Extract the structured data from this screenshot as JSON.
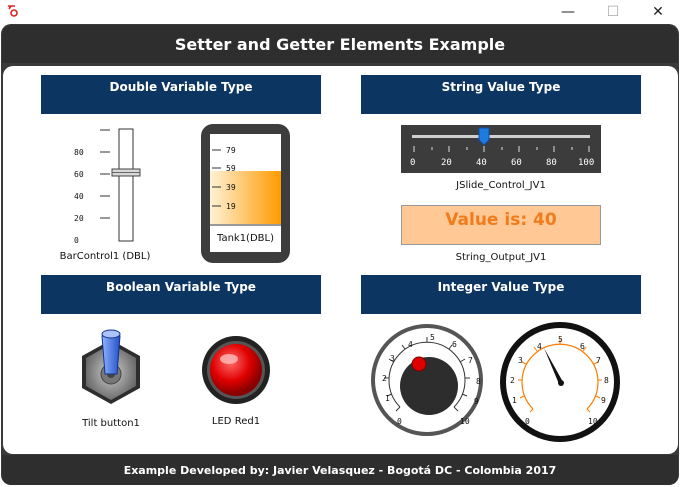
{
  "window": {
    "minimize": "—",
    "maximize": "☐",
    "close": "✕"
  },
  "header": {
    "title": "Setter and Getter Elements Example"
  },
  "footer": {
    "text": "Example Developed by: Javier Velasquez - Bogotá DC - Colombia 2017"
  },
  "sections": {
    "double": "Double Variable Type",
    "string": "String Value Type",
    "boolean": "Boolean Variable Type",
    "integer": "Integer Value Type"
  },
  "bar_control": {
    "label": "BarControl1 (DBL)",
    "ticks": [
      "80",
      "60",
      "40",
      "20",
      "0"
    ],
    "value": 60,
    "max": 100
  },
  "tank": {
    "label": "Tank1(DBL)",
    "ticks": [
      "79",
      "59",
      "39",
      "19"
    ],
    "level_fraction": 0.55
  },
  "jslider": {
    "label": "JSlide_Control_JV1",
    "ticks": [
      "0",
      "20",
      "40",
      "60",
      "80",
      "100"
    ],
    "value": 40
  },
  "string_output": {
    "label": "String_Output_JV1",
    "text": "Value is: 40"
  },
  "tilt_button": {
    "label": "Tilt button1"
  },
  "led": {
    "label": "LED Red1",
    "color": "#e00000",
    "state": "on"
  },
  "knob": {
    "ticks": [
      "0",
      "1",
      "2",
      "3",
      "4",
      "5",
      "6",
      "7",
      "8",
      "9",
      "10"
    ],
    "value": 3.2
  },
  "gauge": {
    "ticks": [
      "0",
      "1",
      "2",
      "3",
      "4",
      "5",
      "6",
      "7",
      "8",
      "9",
      "10"
    ],
    "value": 4.1,
    "accent": "#ff7a00"
  }
}
